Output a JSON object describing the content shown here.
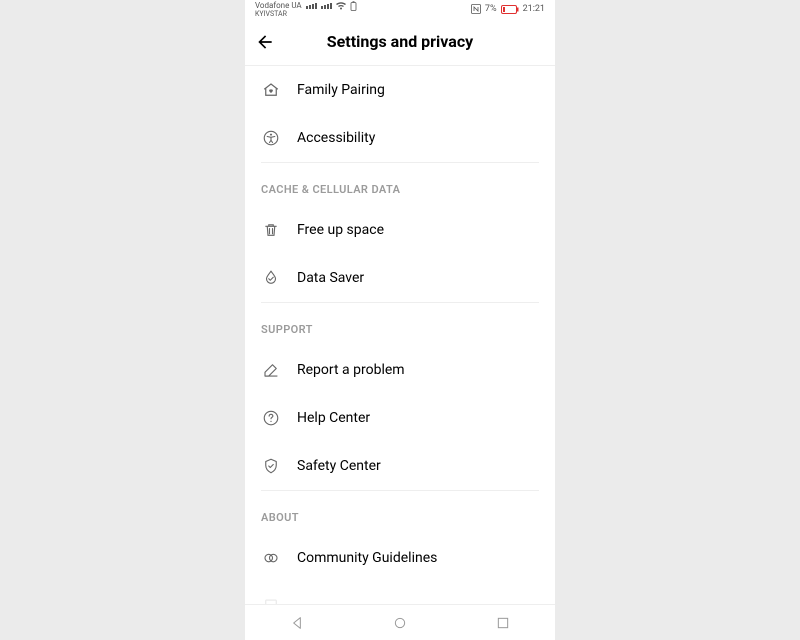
{
  "status": {
    "carrier1": "Vodafone UA",
    "carrier2": "KYIVSTAR",
    "battery_pct": "7%",
    "time": "21:21"
  },
  "header": {
    "title": "Settings and privacy"
  },
  "sections": {
    "s0": {
      "items": {
        "family_pairing": "Family Pairing",
        "accessibility": "Accessibility"
      }
    },
    "cache": {
      "title": "CACHE & CELLULAR DATA",
      "items": {
        "free_up_space": "Free up space",
        "data_saver": "Data Saver"
      }
    },
    "support": {
      "title": "SUPPORT",
      "items": {
        "report_problem": "Report a problem",
        "help_center": "Help Center",
        "safety_center": "Safety Center"
      }
    },
    "about": {
      "title": "ABOUT",
      "items": {
        "community_guidelines": "Community Guidelines"
      }
    }
  }
}
